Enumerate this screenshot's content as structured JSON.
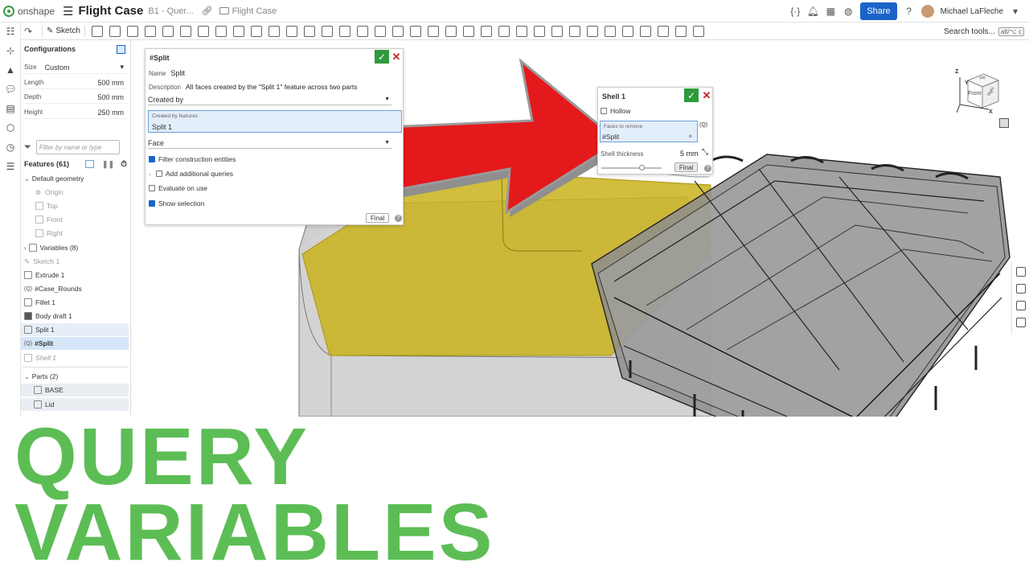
{
  "app": {
    "brand": "onshape",
    "document_title": "Flight Case",
    "tab_subtitle": "B1 - Quer...",
    "folder": "Flight Case",
    "share_label": "Share",
    "user_name": "Michael LaFleche",
    "accent_color": "#1a63c8"
  },
  "toolbar": {
    "sketch_label": "Sketch",
    "search_label": "Search tools...",
    "shortcut_label": "alt/⌥ c"
  },
  "configurations": {
    "title": "Configurations",
    "size_label": "Size",
    "size_value": "Custom",
    "rows": [
      {
        "label": "Length",
        "value": "500 mm"
      },
      {
        "label": "Depth",
        "value": "500 mm"
      },
      {
        "label": "Height",
        "value": "250 mm"
      }
    ]
  },
  "features": {
    "filter_placeholder": "Filter by name or type",
    "header": "Features (61)",
    "items": [
      {
        "label": "Default geometry"
      },
      {
        "label": "Origin"
      },
      {
        "label": "Top"
      },
      {
        "label": "Front"
      },
      {
        "label": "Right"
      },
      {
        "label": "Variables (8)"
      },
      {
        "label": "Sketch 1"
      },
      {
        "label": "Extrude 1"
      },
      {
        "label": "#Case_Rounds"
      },
      {
        "label": "Fillet 1"
      },
      {
        "label": "Body draft 1"
      },
      {
        "label": "Split 1"
      },
      {
        "label": "#Split"
      },
      {
        "label": "Shell 1"
      }
    ],
    "parts_header": "Parts (2)",
    "parts": [
      {
        "label": "BASE"
      },
      {
        "label": "Lid"
      }
    ]
  },
  "split_dialog": {
    "title": "#Split",
    "name_label": "Name",
    "name_value": "Split",
    "desc_label": "Description",
    "desc_value": "All faces created by the \"Split 1\" feature across two parts",
    "created_by": "Created by",
    "created_by_features_label": "Created by features",
    "created_by_features_value": "Split 1",
    "entity_type": "Face",
    "filter_construction": "Filter construction entities",
    "add_queries": "Add additional queries",
    "evaluate_on_use": "Evaluate on use",
    "show_selection": "Show selection",
    "final_label": "Final"
  },
  "shell_dialog": {
    "title": "Shell 1",
    "hollow_label": "Hollow",
    "faces_label": "Faces to remove",
    "faces_value": "#Split",
    "thickness_label": "Shell thickness",
    "thickness_value": "5 mm",
    "final_label": "Final"
  },
  "navcube": {
    "top": "Top",
    "front": "Front",
    "right": "Right",
    "axis_z": "Z",
    "axis_y": "Y",
    "axis_x": "X"
  },
  "headline": {
    "line1": "QUERY",
    "line2": "VARIABLES",
    "color": "#5cbd55"
  }
}
